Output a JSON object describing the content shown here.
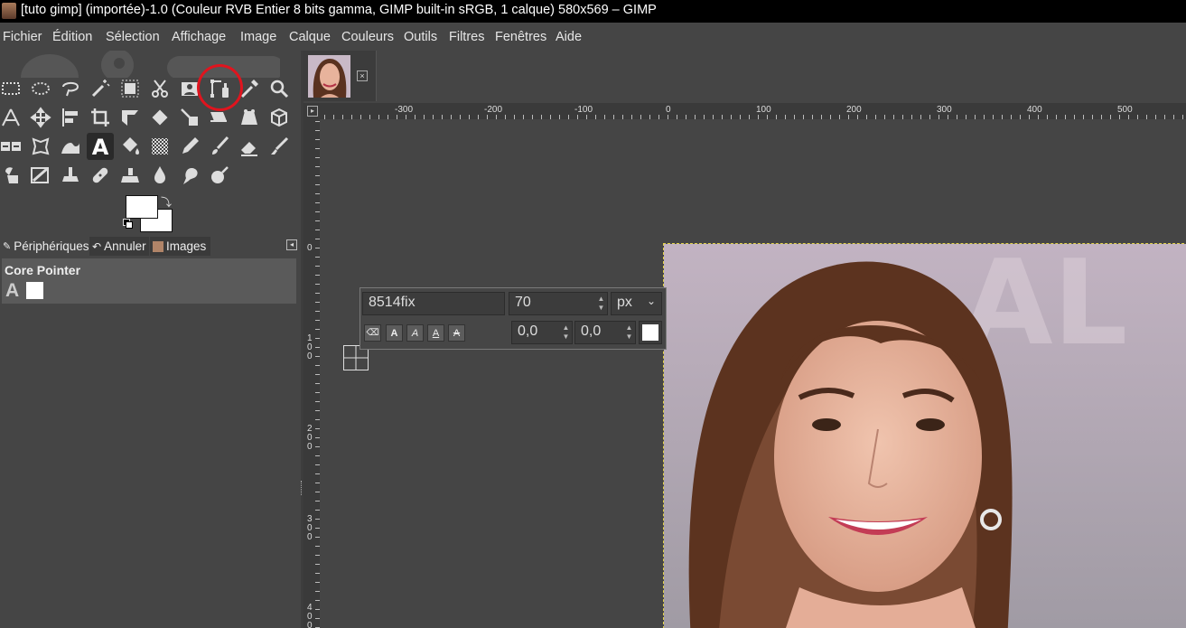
{
  "window": {
    "title": "[tuto gimp] (importée)-1.0 (Couleur RVB Entier 8 bits gamma, GIMP built-in sRGB, 1 calque) 580x569 – GIMP"
  },
  "menu": [
    "Fichier",
    "Édition",
    "Sélection",
    "Affichage",
    "Image",
    "Calque",
    "Couleurs",
    "Outils",
    "Filtres",
    "Fenêtres",
    "Aide"
  ],
  "toolbox": {
    "active_tool": "text-icon",
    "highlighted_tool": "paths-icon",
    "highlight_color": "#e0141e",
    "tool_rows": [
      [
        "rect-select-icon",
        "ellipse-select-icon",
        "free-select-icon",
        "fuzzy-select-icon",
        "select-by-color-icon",
        "scissors-select-icon",
        "foreground-select-icon",
        "paths-icon",
        "color-picker-icon",
        "zoom-icon"
      ],
      [
        "measure-icon",
        "move-icon",
        "align-icon",
        "crop-icon",
        "unified-transform-icon",
        "rotate-icon",
        "scale-icon",
        "shear-icon",
        "perspective-icon",
        "3d-transform-icon"
      ],
      [
        "flip-icon",
        "cage-icon",
        "warp-icon",
        "text-icon",
        "bucket-fill-icon",
        "gradient-icon",
        "pencil-icon",
        "paintbrush-icon",
        "eraser-icon",
        "airbrush-icon"
      ],
      [
        "ink-icon",
        "mypaint-brush-icon",
        "clone-icon",
        "heal-icon",
        "perspective-clone-icon",
        "blur-icon",
        "smudge-icon",
        "dodge-burn-icon"
      ]
    ],
    "fg_color": "#ffffff",
    "bg_color": "#ffffff"
  },
  "dock_tabs": {
    "tabs": [
      {
        "label": "Périphériques",
        "icon": "devices-icon"
      },
      {
        "label": "Annuler",
        "icon": "undo-icon"
      },
      {
        "label": "Images",
        "icon": "images-icon"
      }
    ]
  },
  "devices": {
    "core_pointer_label": "Core Pointer",
    "tool_glyph": "A"
  },
  "rulers": {
    "top_labels": [
      "-300",
      "-200",
      "-100",
      "0",
      "100",
      "200",
      "300",
      "400",
      "500"
    ],
    "left_labels": [
      "0",
      "100",
      "200",
      "300",
      "400"
    ]
  },
  "text_toolbox": {
    "font": "8514fix",
    "size": "70",
    "unit": "px",
    "baseline": "0,0",
    "kerning": "0,0",
    "text_color": "#ffffff",
    "style_buttons": [
      "A",
      "A",
      "A",
      "A"
    ]
  }
}
